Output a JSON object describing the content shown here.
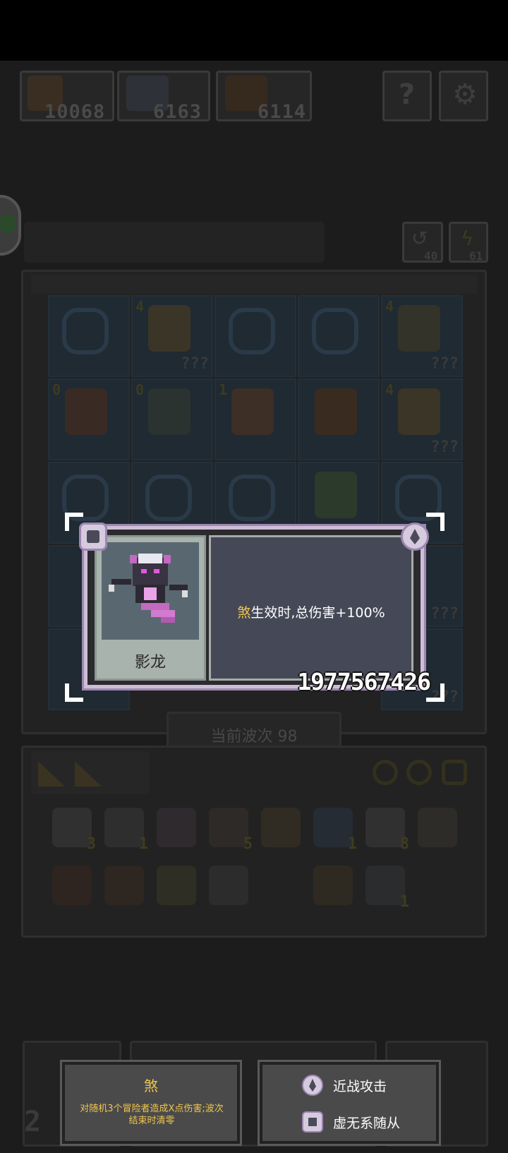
{
  "resources": [
    {
      "icon": "blood-resource-icon",
      "value": "10068"
    },
    {
      "icon": "monster-resource-icon",
      "value": "6163"
    },
    {
      "icon": "bow-resource-icon",
      "value": "6114"
    }
  ],
  "top_buttons": {
    "help_icon": "question-icon",
    "settings_icon": "gear-icon"
  },
  "chat_icon": "chat-bubble-icon",
  "counters": [
    {
      "icon": "refresh-icon",
      "value": "40"
    },
    {
      "icon": "lightning-icon",
      "value": "61"
    }
  ],
  "grid": {
    "rows": [
      [
        {
          "type": "empty"
        },
        {
          "type": "unit",
          "level": "4",
          "hidden": "???"
        },
        {
          "type": "empty"
        },
        {
          "type": "empty"
        },
        {
          "type": "unit",
          "level": "4",
          "hidden": "???"
        }
      ],
      [
        {
          "type": "unit",
          "level": "0"
        },
        {
          "type": "unit",
          "level": "0"
        },
        {
          "type": "unit",
          "level": "1"
        },
        {
          "type": "unit",
          "level": ""
        },
        {
          "type": "unit",
          "level": "4",
          "hidden": "???"
        }
      ],
      [
        {
          "type": "empty"
        },
        {
          "type": "empty"
        },
        {
          "type": "empty"
        },
        {
          "type": "unit",
          "level": ""
        },
        {
          "type": "empty"
        }
      ],
      [
        {
          "type": "unit",
          "level": ""
        },
        {
          "type": "empty"
        },
        {
          "type": "empty"
        },
        {
          "type": "empty"
        },
        {
          "type": "unit",
          "level": "",
          "hidden": "???"
        }
      ],
      [
        {
          "type": "unit",
          "level": ""
        },
        {
          "type": "empty"
        },
        {
          "type": "empty"
        },
        {
          "type": "empty"
        },
        {
          "type": "unit",
          "level": "",
          "hidden": "???"
        }
      ]
    ]
  },
  "wave_label": "当前波次 98",
  "inventory": {
    "row1": [
      {
        "count": "3"
      },
      {
        "count": "1"
      },
      {
        "count": ""
      },
      {
        "count": "5"
      },
      {
        "count": ""
      },
      {
        "count": "1"
      },
      {
        "count": "8"
      },
      {
        "count": ""
      }
    ],
    "row2": [
      {
        "count": ""
      },
      {
        "count": ""
      },
      {
        "count": ""
      },
      {
        "count": ""
      },
      {
        "count": ""
      },
      {
        "count": ""
      },
      {
        "count": "1"
      },
      {
        "count": ""
      }
    ]
  },
  "card": {
    "name": "影龙",
    "keyword": "煞",
    "description_rest": "生效时,总伤害+100%",
    "power": "1977567426",
    "top_left_icon": "void-summon-icon",
    "top_right_icon": "melee-attack-icon"
  },
  "tooltip_left": {
    "title": "煞",
    "text": "对随机3个冒险者造成X点伤害;波次结束时清零"
  },
  "tooltip_right": {
    "items": [
      {
        "icon": "melee-attack-icon",
        "label": "近战攻击"
      },
      {
        "icon": "void-summon-icon",
        "label": "虚无系随从"
      }
    ]
  },
  "bottom_left_digit": "2",
  "colors": {
    "keyword": "#f0c64e",
    "card_border": "#9d86b2",
    "panel": "#454857"
  }
}
